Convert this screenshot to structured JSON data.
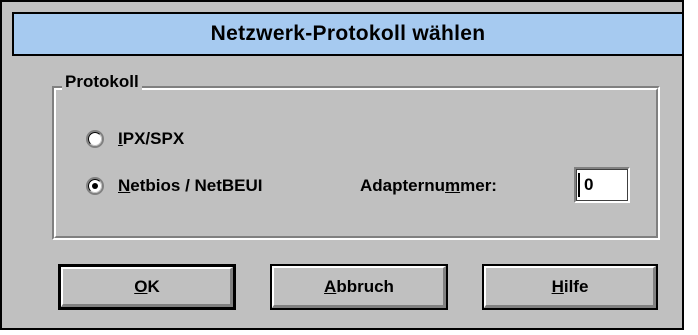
{
  "dialog": {
    "title": "Netzwerk-Protokoll wählen"
  },
  "group": {
    "label": "Protokoll",
    "options": [
      {
        "first": "I",
        "rest": "PX/SPX",
        "selected": false
      },
      {
        "first": "N",
        "rest": "etbios / NetBEUI",
        "selected": true
      }
    ]
  },
  "adapter": {
    "label_pre": "Adapternu",
    "label_u": "m",
    "label_post": "mer:",
    "value": "0"
  },
  "buttons": {
    "ok": {
      "u": "O",
      "rest": "K"
    },
    "cancel": {
      "u": "A",
      "rest": "bbruch"
    },
    "help": {
      "u": "H",
      "rest": "ilfe"
    }
  },
  "colors": {
    "titlebar": "#a6caf0",
    "face": "#c0c0c0"
  }
}
